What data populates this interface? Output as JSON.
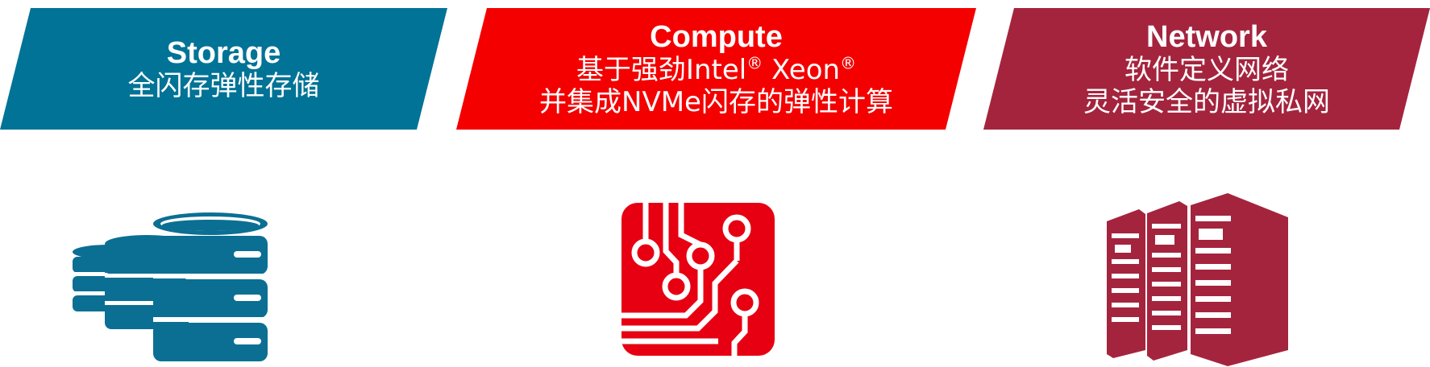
{
  "colors": {
    "storage": "#007396",
    "compute": "#f40000",
    "network": "#a4243e"
  },
  "storage": {
    "title": "Storage",
    "subtitle": "全闪存弹性存储",
    "icon": "database-stack-icon"
  },
  "compute": {
    "title": "Compute",
    "line1_prefix": "基于强劲Intel",
    "line1_mark1": "®",
    "line1_middle": " Xeon",
    "line1_mark2": "®",
    "line2": "并集成NVMe闪存的弹性计算",
    "icon": "circuit-board-icon"
  },
  "network": {
    "title": "Network",
    "line1": "软件定义网络",
    "line2": "灵活安全的虚拟私网",
    "icon": "server-rack-icon"
  }
}
